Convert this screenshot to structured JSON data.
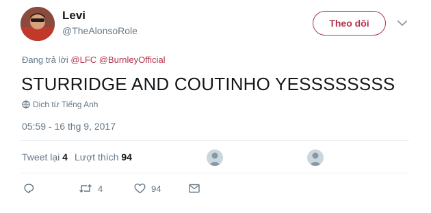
{
  "user": {
    "name": "Levi",
    "handle": "@TheAlonsoRole"
  },
  "follow_button": {
    "label": "Theo dõi"
  },
  "reply": {
    "prefix": "Đang trả lời",
    "mentions": [
      "@LFC",
      "@Burnley​Official"
    ]
  },
  "tweet": {
    "text": "STURRIDGE AND COUTINHO YESSSSSSSS",
    "translate_label": "Dịch từ Tiếng Anh",
    "timestamp": "05:59 - 16 thg 9, 2017"
  },
  "stats": {
    "retweet_label": "Tweet lại",
    "retweet_count": "4",
    "like_label": "Lượt thích",
    "like_count": "94"
  },
  "actions": {
    "reply_icon": "reply-icon",
    "retweet_count": "4",
    "like_count": "94",
    "dm_icon": "envelope-icon"
  },
  "colors": {
    "accent": "#b0324a",
    "muted": "#657786",
    "divider": "#e6ecf0"
  }
}
